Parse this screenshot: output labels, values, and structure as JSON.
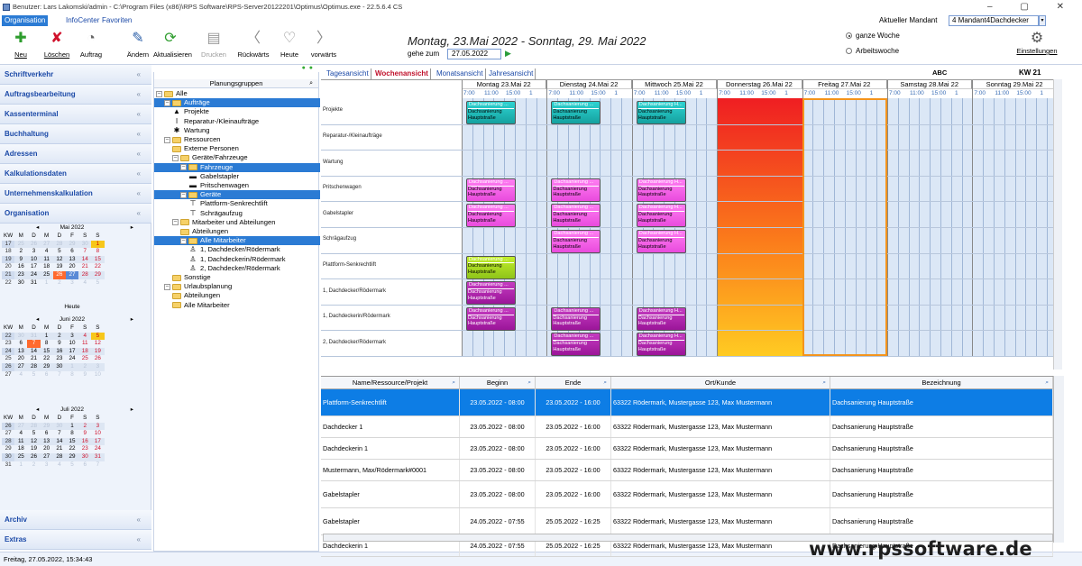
{
  "window": {
    "title": "Benutzer: Lars Lakomski/admin - C:\\Program Files (x86)\\RPS Software\\RPS-Server20122201\\Optimus\\Optimus.exe - 22.5.6.4 CS",
    "controls": "–  ▢  ✕"
  },
  "menu": {
    "items": [
      "Organisation",
      "InfoCenter",
      "Favoriten"
    ]
  },
  "mandant": {
    "label": "Aktueller Mandant",
    "value": "4 Mandant4Dachdecker"
  },
  "toolbar": {
    "buttons": [
      {
        "label": "Neu",
        "icon": "plus-icon",
        "glyph": "✚",
        "color": "#2e9d2e",
        "disabled": false
      },
      {
        "label": "Löschen",
        "icon": "delete-icon",
        "glyph": "✘",
        "color": "#d0112b",
        "disabled": false
      },
      {
        "label": "Auftrag",
        "icon": "order-icon",
        "glyph": "◔",
        "color": "#666",
        "disabled": false
      },
      {
        "label": "Ändern",
        "icon": "edit-icon",
        "glyph": "✎",
        "color": "#2b5fa8",
        "disabled": false
      },
      {
        "label": "Aktualisieren",
        "icon": "refresh-icon",
        "glyph": "⟳",
        "color": "#2e9d2e",
        "disabled": false
      },
      {
        "label": "Drucken",
        "icon": "print-icon",
        "glyph": "▤",
        "color": "#999",
        "disabled": true
      },
      {
        "label": "Rückwärts",
        "icon": "back-icon",
        "glyph": "〈",
        "color": "#888",
        "disabled": false
      },
      {
        "label": "Heute",
        "icon": "today-icon",
        "glyph": "♡",
        "color": "#888",
        "disabled": false
      },
      {
        "label": "vorwärts",
        "icon": "forward-icon",
        "glyph": "〉",
        "color": "#888",
        "disabled": false
      }
    ],
    "date_title": "Montag, 23.Mai 2022  -  Sonntag, 29. Mai 2022",
    "goto_label": "gehe zum",
    "goto_value": "27.05.2022",
    "radio": [
      {
        "label": "ganze Woche",
        "checked": true
      },
      {
        "label": "Arbeitswoche",
        "checked": false
      }
    ],
    "settings_label": "Einstellungen"
  },
  "sidebar": {
    "sections_top": [
      "Schriftverkehr",
      "Auftragsbearbeitung",
      "Kassenterminal",
      "Buchhaltung",
      "Adressen",
      "Kalkulationsdaten",
      "Unternehmenskalkulation",
      "Organisation"
    ],
    "sections_bottom": [
      "Archiv",
      "Extras"
    ],
    "today_label": "Heute",
    "weekday_header": [
      "KW",
      "M",
      "D",
      "M",
      "D",
      "F",
      "S",
      "S"
    ],
    "calendars": [
      {
        "title": "Mai 2022",
        "weeks": [
          [
            "17",
            "25",
            "26",
            "27",
            "28",
            "29",
            "30",
            "1"
          ],
          [
            "18",
            "2",
            "3",
            "4",
            "5",
            "6",
            "7",
            "8"
          ],
          [
            "19",
            "9",
            "10",
            "11",
            "12",
            "13",
            "14",
            "15"
          ],
          [
            "20",
            "16",
            "17",
            "18",
            "19",
            "20",
            "21",
            "22"
          ],
          [
            "21",
            "23",
            "24",
            "25",
            "26",
            "27",
            "28",
            "29"
          ],
          [
            "22",
            "30",
            "31",
            "1",
            "2",
            "3",
            "4",
            "5"
          ]
        ]
      },
      {
        "title": "Juni 2022",
        "weeks": [
          [
            "22",
            "30",
            "31",
            "1",
            "2",
            "3",
            "4",
            "5"
          ],
          [
            "23",
            "6",
            "7",
            "8",
            "9",
            "10",
            "11",
            "12"
          ],
          [
            "24",
            "13",
            "14",
            "15",
            "16",
            "17",
            "18",
            "19"
          ],
          [
            "25",
            "20",
            "21",
            "22",
            "23",
            "24",
            "25",
            "26"
          ],
          [
            "26",
            "27",
            "28",
            "29",
            "30",
            "1",
            "2",
            "3"
          ],
          [
            "27",
            "4",
            "5",
            "6",
            "7",
            "8",
            "9",
            "10"
          ]
        ]
      },
      {
        "title": "Juli 2022",
        "weeks": [
          [
            "26",
            "27",
            "28",
            "29",
            "30",
            "1",
            "2",
            "3"
          ],
          [
            "27",
            "4",
            "5",
            "6",
            "7",
            "8",
            "9",
            "10"
          ],
          [
            "28",
            "11",
            "12",
            "13",
            "14",
            "15",
            "16",
            "17"
          ],
          [
            "29",
            "18",
            "19",
            "20",
            "21",
            "22",
            "23",
            "24"
          ],
          [
            "30",
            "25",
            "26",
            "27",
            "28",
            "29",
            "30",
            "31"
          ],
          [
            "31",
            "1",
            "2",
            "3",
            "4",
            "5",
            "6",
            "7"
          ]
        ]
      }
    ]
  },
  "status": {
    "text": "Freitag, 27.05.2022, 15:34:43"
  },
  "tree": {
    "header": "Planungsgruppen",
    "nodes": [
      {
        "label": "Alle",
        "level": 0,
        "kind": "folder",
        "toggle": "⊟",
        "selected": false
      },
      {
        "label": "Aufträge",
        "level": 1,
        "kind": "folder",
        "toggle": "⊟",
        "selected": true
      },
      {
        "label": "Projekte",
        "level": 2,
        "kind": "icon",
        "glyph": "▲",
        "selected": false
      },
      {
        "label": "Reparatur-/Kleinaufträge",
        "level": 2,
        "kind": "icon",
        "glyph": "ǀ",
        "selected": false
      },
      {
        "label": "Wartung",
        "level": 2,
        "kind": "icon",
        "glyph": "✱",
        "selected": false
      },
      {
        "label": "Ressourcen",
        "level": 1,
        "kind": "folder",
        "toggle": "⊟",
        "selected": false
      },
      {
        "label": "Externe Personen",
        "level": 2,
        "kind": "folder",
        "selected": false
      },
      {
        "label": "Geräte/Fahrzeuge",
        "level": 2,
        "kind": "folder",
        "toggle": "⊟",
        "selected": false
      },
      {
        "label": "Fahrzeuge",
        "level": 3,
        "kind": "folder",
        "toggle": "⊟",
        "selected": true
      },
      {
        "label": "Gabelstapler",
        "level": 4,
        "kind": "icon",
        "glyph": "▬",
        "selected": false
      },
      {
        "label": "Pritschenwagen",
        "level": 4,
        "kind": "icon",
        "glyph": "▬",
        "selected": false
      },
      {
        "label": "Geräte",
        "level": 3,
        "kind": "folder",
        "toggle": "⊟",
        "selected": true
      },
      {
        "label": "Plattform-Senkrechtlift",
        "level": 4,
        "kind": "icon",
        "glyph": "⊤",
        "selected": false
      },
      {
        "label": "Schrägaufzug",
        "level": 4,
        "kind": "icon",
        "glyph": "⊤",
        "selected": false
      },
      {
        "label": "Mitarbeiter und Abteilungen",
        "level": 2,
        "kind": "folder",
        "toggle": "⊟",
        "selected": false
      },
      {
        "label": "Abteilungen",
        "level": 3,
        "kind": "folder",
        "selected": false
      },
      {
        "label": "Alle Mitarbeiter",
        "level": 3,
        "kind": "folder",
        "toggle": "⊟",
        "selected": true
      },
      {
        "label": "1, Dachdecker/Rödermark",
        "level": 4,
        "kind": "icon",
        "glyph": "♙",
        "selected": false
      },
      {
        "label": "1, Dachdeckerin/Rödermark",
        "level": 4,
        "kind": "icon",
        "glyph": "♙",
        "selected": false
      },
      {
        "label": "2, Dachdecker/Rödermark",
        "level": 4,
        "kind": "icon",
        "glyph": "♙",
        "selected": false
      },
      {
        "label": "Sonstige",
        "level": 2,
        "kind": "folder",
        "selected": false
      },
      {
        "label": "Urlaubsplanung",
        "level": 1,
        "kind": "folder",
        "toggle": "⊟",
        "selected": false
      },
      {
        "label": "Abteilungen",
        "level": 2,
        "kind": "folder",
        "selected": false
      },
      {
        "label": "Alle Mitarbeiter",
        "level": 2,
        "kind": "folder",
        "selected": false
      }
    ]
  },
  "planner": {
    "tabs": [
      "Tagesansicht",
      "Wochenansicht",
      "Monatsansicht",
      "Jahresansicht"
    ],
    "active_tab": 1,
    "abc": "ABC",
    "kw": "KW  21",
    "days": [
      "Montag 23.Mai 22",
      "Dienstag 24.Mai 22",
      "Mittwoch 25.Mai 22",
      "Donnerstag 26.Mai 22",
      "Freitag 27.Mai 22",
      "Samstag 28.Mai 22",
      "Sonntag 29.Mai 22"
    ],
    "hours": [
      "7:00",
      "11:00",
      "15:00",
      "1"
    ],
    "holiday_day": 3,
    "today_day": 4,
    "rows": [
      "Projekte",
      "Reparatur-/Kleinaufträge",
      "Wartung",
      "Pritschenwagen",
      "Gabelstapler",
      "Schrägaufzug",
      "Plattform-Senkrechtlift",
      "1, Dachdecker/Rödermark",
      "1, Dachdeckerin/Rödermark",
      "2, Dachdecker/Rödermark"
    ],
    "events": [
      {
        "row": 0,
        "day": 0,
        "color": "c",
        "title": "Dachsanierung ...",
        "l1": "Dachsanierung",
        "l2": "Hauptstraße"
      },
      {
        "row": 0,
        "day": 1,
        "color": "c",
        "title": "Dachsanierung ...",
        "l1": "Dachsanierung",
        "l2": "Hauptstraße"
      },
      {
        "row": 0,
        "day": 2,
        "color": "c",
        "title": "Dachsanierung H...",
        "l1": "Dachsanierung",
        "l2": "Hauptstraße"
      },
      {
        "row": 3,
        "day": 0,
        "color": "p",
        "title": "Dachsanierung ...",
        "l1": "Dachsanierung",
        "l2": "Hauptstraße"
      },
      {
        "row": 3,
        "day": 1,
        "color": "p",
        "title": "Dachsanierung ...",
        "l1": "Dachsanierung",
        "l2": "Hauptstraße"
      },
      {
        "row": 3,
        "day": 2,
        "color": "p",
        "title": "Dachsanierung H...",
        "l1": "Dachsanierung",
        "l2": "Hauptstraße"
      },
      {
        "row": 4,
        "day": 0,
        "color": "p",
        "title": "Dachsanierung ...",
        "l1": "Dachsanierung",
        "l2": "Hauptstraße"
      },
      {
        "row": 4,
        "day": 1,
        "color": "p",
        "title": "Dachsanierung ...",
        "l1": "Dachsanierung",
        "l2": "Hauptstraße"
      },
      {
        "row": 4,
        "day": 2,
        "color": "p",
        "title": "Dachsanierung H...",
        "l1": "Dachsanierung",
        "l2": "Hauptstraße"
      },
      {
        "row": 5,
        "day": 1,
        "color": "p",
        "title": "Dachsanierung ...",
        "l1": "Dachsanierung",
        "l2": "Hauptstraße"
      },
      {
        "row": 5,
        "day": 2,
        "color": "p",
        "title": "Dachsanierung H...",
        "l1": "Dachsanierung",
        "l2": "Hauptstraße"
      },
      {
        "row": 6,
        "day": 0,
        "color": "y",
        "title": "Dachsanierung ...",
        "l1": "Dachsanierung",
        "l2": "Hauptstraße"
      },
      {
        "row": 7,
        "day": 0,
        "color": "m",
        "title": "Dachsanierung ...",
        "l1": "Dachsanierung",
        "l2": "Hauptstraße"
      },
      {
        "row": 8,
        "day": 0,
        "color": "m",
        "title": "Dachsanierung ...",
        "l1": "Dachsanierung",
        "l2": "Hauptstraße"
      },
      {
        "row": 8,
        "day": 1,
        "color": "m",
        "title": "Dachsanierung ...",
        "l1": "Dachsanierung",
        "l2": "Hauptstraße"
      },
      {
        "row": 8,
        "day": 2,
        "color": "m",
        "title": "Dachsanierung H...",
        "l1": "Dachsanierung",
        "l2": "Hauptstraße"
      },
      {
        "row": 9,
        "day": 1,
        "color": "m",
        "title": "Dachsanierung ...",
        "l1": "Dachsanierung",
        "l2": "Hauptstraße"
      },
      {
        "row": 9,
        "day": 2,
        "color": "m",
        "title": "Dachsanierung H...",
        "l1": "Dachsanierung",
        "l2": "Hauptstraße"
      }
    ]
  },
  "list": {
    "headers": [
      "Name/Ressource/Projekt",
      "Beginn",
      "Ende",
      "Ort/Kunde",
      "Bezeichnung"
    ],
    "rows": [
      [
        "Plattform-Senkrechtlift",
        "23.05.2022 - 08:00",
        "23.05.2022 - 16:00",
        "63322 Rödermark, Mustergasse 123, Max Mustermann",
        "Dachsanierung Hauptstraße"
      ],
      [
        "Dachdecker 1",
        "23.05.2022 - 08:00",
        "23.05.2022 - 16:00",
        "63322 Rödermark, Mustergasse 123, Max Mustermann",
        "Dachsanierung Hauptstraße"
      ],
      [
        "Dachdeckerin 1",
        "23.05.2022 - 08:00",
        "23.05.2022 - 16:00",
        "63322 Rödermark, Mustergasse 123, Max Mustermann",
        "Dachsanierung Hauptstraße"
      ],
      [
        "Mustermann, Max/Rödermark#0001",
        "23.05.2022 - 08:00",
        "23.05.2022 - 16:00",
        "63322 Rödermark, Mustergasse 123, Max Mustermann",
        "Dachsanierung Hauptstraße"
      ],
      [
        "Gabelstapler",
        "23.05.2022 - 08:00",
        "23.05.2022 - 16:00",
        "63322 Rödermark, Mustergasse 123, Max Mustermann",
        "Dachsanierung Hauptstraße"
      ],
      [
        "Gabelstapler",
        "24.05.2022 - 07:55",
        "25.05.2022 - 16:25",
        "63322 Rödermark, Mustergasse 123, Max Mustermann",
        "Dachsanierung Hauptstraße"
      ],
      [
        "Dachdeckerin 1",
        "24.05.2022 - 07:55",
        "25.05.2022 - 16:25",
        "63322 Rödermark, Mustergasse 123, Max Mustermann",
        "Dachsanierung Hauptstraße"
      ]
    ]
  },
  "watermark": "www.rpssoftware.de"
}
